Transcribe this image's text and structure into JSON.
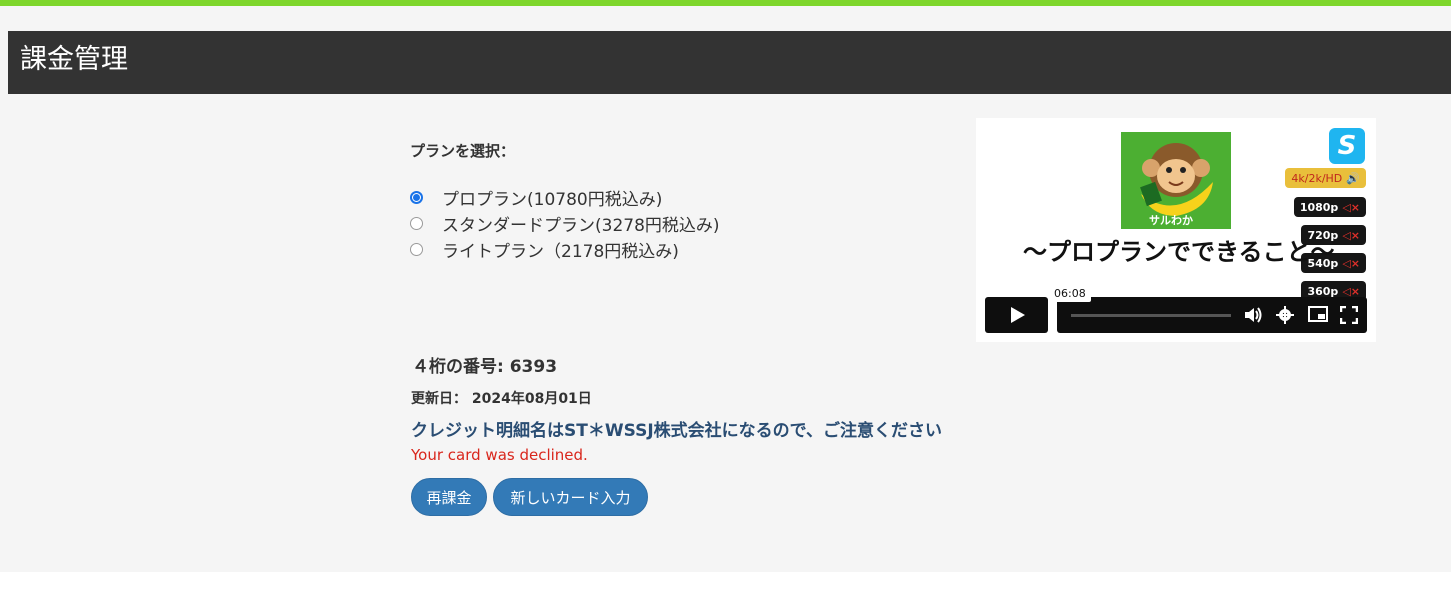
{
  "colors": {
    "accent_bar": "#7ed62c",
    "header_bg": "#333333",
    "button": "#337ab7",
    "error": "#d9261c",
    "notice": "#2a4d73"
  },
  "header": {
    "title": "課金管理"
  },
  "plans": {
    "label": "プランを選択：",
    "options": [
      {
        "label": "プロプラン(10780円税込み)",
        "selected": true
      },
      {
        "label": "スタンダードプラン(3278円税込み)",
        "selected": false
      },
      {
        "label": "ライトプラン（2178円税込み)",
        "selected": false
      }
    ]
  },
  "card": {
    "digits_text": "４桁の番号: 6393",
    "updated_text": "更新日： 2024年08月01日",
    "notice": "クレジット明細名はST＊WSSJ株式会社になるので、ご注意ください",
    "error": "Your card was declined."
  },
  "buttons": {
    "recharge": "再課金",
    "new_card": "新しいカード入力"
  },
  "video": {
    "brand_letter": "S",
    "thumb_text": "サルわか",
    "title": "～プロプランでできること～",
    "qualities": [
      "4k/2k/HD",
      "1080p",
      "720p",
      "540p",
      "360p"
    ],
    "time": "06:08",
    "icons": [
      "play-icon",
      "volume-icon",
      "settings-icon",
      "pip-icon",
      "fullscreen-icon"
    ]
  }
}
